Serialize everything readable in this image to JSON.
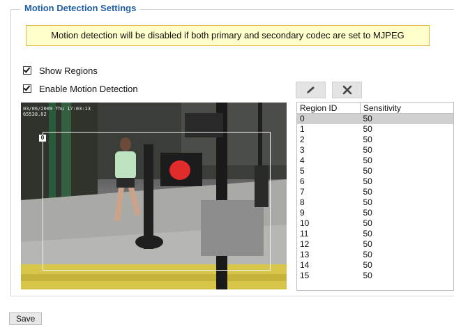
{
  "section": {
    "title": "Motion Detection Settings"
  },
  "notice": {
    "text": "Motion detection will be disabled if both primary and secondary codec are set to MJPEG"
  },
  "options": {
    "show_regions": {
      "label": "Show Regions",
      "checked": true
    },
    "enable_motion": {
      "label": "Enable Motion Detection",
      "checked": true
    }
  },
  "toolbar": {
    "edit_icon": "pencil-icon",
    "delete_icon": "x-icon"
  },
  "video": {
    "timestamp_line1": "03/06/2009 Thu 17:03:13",
    "timestamp_line2": "65538.02",
    "region_label": "0"
  },
  "table": {
    "headers": [
      "Region ID",
      "Sensitivity"
    ],
    "selected_index": 0,
    "rows": [
      [
        "0",
        "50"
      ],
      [
        "1",
        "50"
      ],
      [
        "2",
        "50"
      ],
      [
        "3",
        "50"
      ],
      [
        "4",
        "50"
      ],
      [
        "5",
        "50"
      ],
      [
        "6",
        "50"
      ],
      [
        "7",
        "50"
      ],
      [
        "8",
        "50"
      ],
      [
        "9",
        "50"
      ],
      [
        "10",
        "50"
      ],
      [
        "11",
        "50"
      ],
      [
        "12",
        "50"
      ],
      [
        "13",
        "50"
      ],
      [
        "14",
        "50"
      ],
      [
        "15",
        "50"
      ]
    ]
  },
  "save": {
    "label": "Save"
  },
  "colors": {
    "title": "#1f5fa8",
    "notice_bg": "#ffffcc",
    "notice_border": "#e0b94a",
    "selected_row": "#d0d0d0"
  }
}
